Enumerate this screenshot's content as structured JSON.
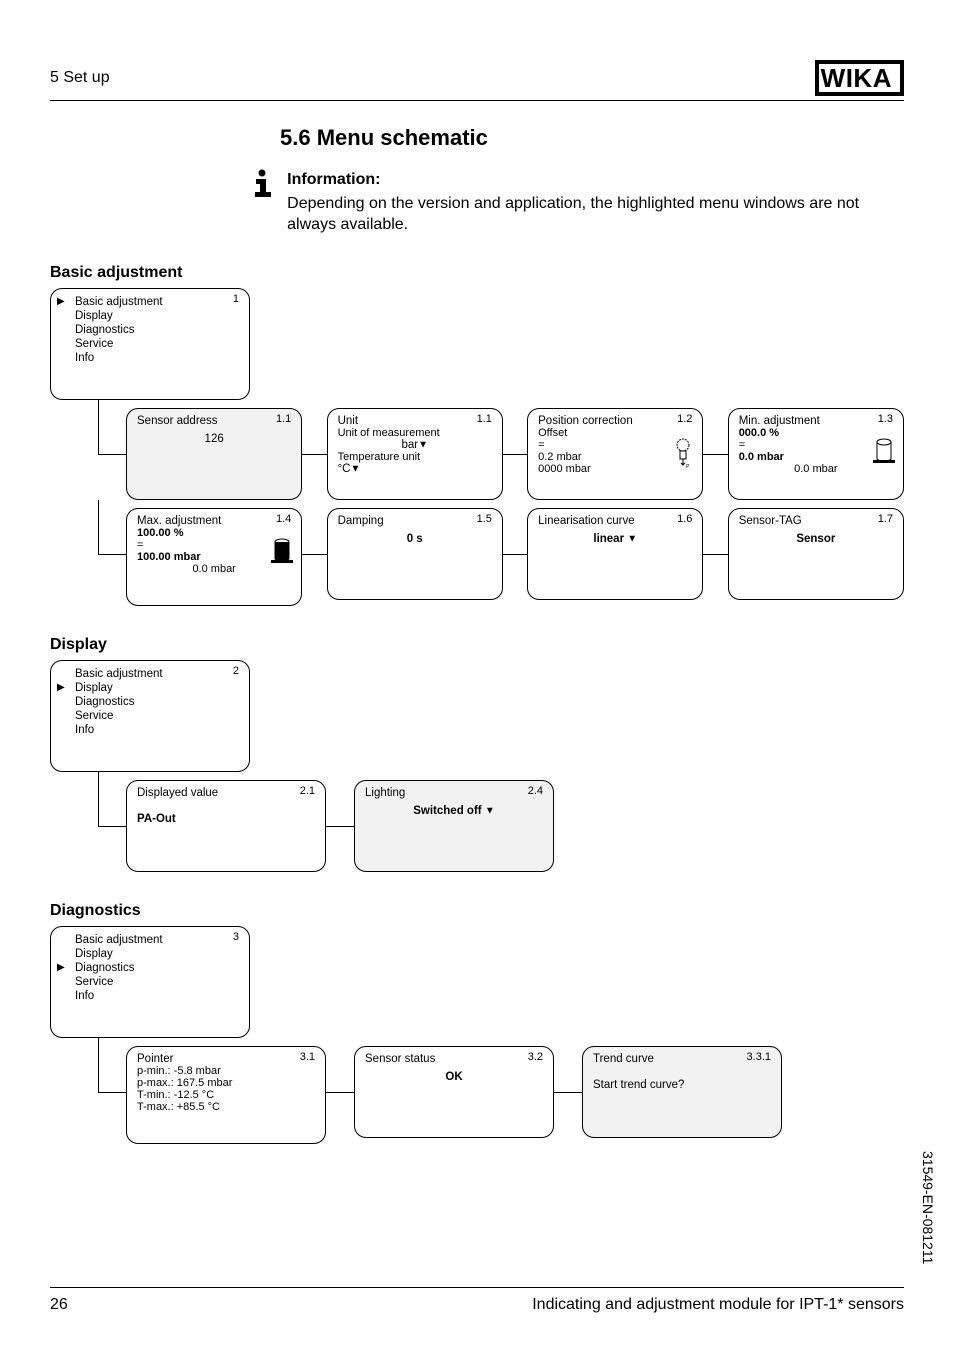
{
  "header": {
    "section": "5  Set up",
    "logo": "WIKA"
  },
  "title": "5.6   Menu schematic",
  "information": {
    "label": "Information:",
    "text": "Depending on the version and application, the highlighted menu windows are not always available."
  },
  "basic": {
    "heading": "Basic adjustment",
    "menu": {
      "num": "1",
      "items": [
        "Basic adjustment",
        "Display",
        "Diagnostics",
        "Service",
        "Info"
      ],
      "selected": 0
    },
    "r1": {
      "sensor_addr": {
        "num": "1.1",
        "title": "Sensor address",
        "value": "126"
      },
      "unit": {
        "num": "1.1",
        "title": "Unit",
        "l1": "Unit of measurement",
        "v1": "bar",
        "l2": "Temperature unit",
        "v2": "°C"
      },
      "position": {
        "num": "1.2",
        "title": "Position correction",
        "l1": "Offset",
        "eq": "=",
        "v1": "0.2 mbar",
        "v2": "0000 mbar"
      },
      "minadj": {
        "num": "1.3",
        "title": "Min. adjustment",
        "p": "000.0 %",
        "eq": "=",
        "v": "0.0 mbar",
        "ref": "0.0 mbar"
      }
    },
    "r2": {
      "maxadj": {
        "num": "1.4",
        "title": "Max. adjustment",
        "p": "100.00 %",
        "eq": "=",
        "v": "100.00 mbar",
        "ref": "0.0 mbar"
      },
      "damping": {
        "num": "1.5",
        "title": "Damping",
        "value": "0 s"
      },
      "lin": {
        "num": "1.6",
        "title": "Linearisation curve",
        "value": "linear"
      },
      "tag": {
        "num": "1.7",
        "title": "Sensor-TAG",
        "value": "Sensor"
      }
    }
  },
  "display": {
    "heading": "Display",
    "menu": {
      "num": "2",
      "items": [
        "Basic adjustment",
        "Display",
        "Diagnostics",
        "Service",
        "Info"
      ],
      "selected": 1
    },
    "displayed": {
      "num": "2.1",
      "title": "Displayed value",
      "value": "PA-Out"
    },
    "lighting": {
      "num": "2.4",
      "title": "Lighting",
      "value": "Switched off"
    }
  },
  "diagnostics": {
    "heading": "Diagnostics",
    "menu": {
      "num": "3",
      "items": [
        "Basic adjustment",
        "Display",
        "Diagnostics",
        "Service",
        "Info"
      ],
      "selected": 2
    },
    "pointer": {
      "num": "3.1",
      "title": "Pointer",
      "l1": "p-min.: -5.8 mbar",
      "l2": "p-max.: 167.5 mbar",
      "l3": "T-min.: -12.5 °C",
      "l4": "T-max.: +85.5 °C"
    },
    "status": {
      "num": "3.2",
      "title": "Sensor status",
      "value": "OK"
    },
    "trend": {
      "num": "3.3.1",
      "title": "Trend curve",
      "value": "Start trend curve?"
    }
  },
  "footer": {
    "page": "26",
    "title": "Indicating and adjustment module for IPT-1* sensors"
  },
  "docid": "31549-EN-081211"
}
